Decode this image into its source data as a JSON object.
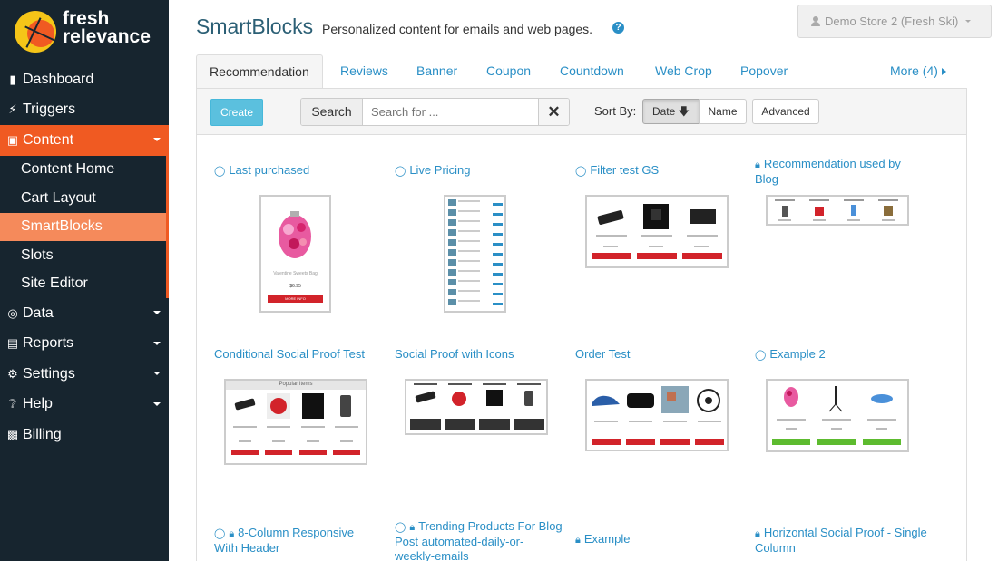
{
  "brand": {
    "line1": "fresh",
    "line2": "relevance"
  },
  "sidebar": {
    "items": [
      {
        "label": "Dashboard",
        "icon": "bookmark-icon"
      },
      {
        "label": "Triggers",
        "icon": "bolt-icon"
      },
      {
        "label": "Content",
        "icon": "image-icon"
      },
      {
        "label": "Data",
        "icon": "target-icon"
      },
      {
        "label": "Reports",
        "icon": "list-icon"
      },
      {
        "label": "Settings",
        "icon": "gear-icon"
      },
      {
        "label": "Help",
        "icon": "question-icon"
      },
      {
        "label": "Billing",
        "icon": "briefcase-icon"
      }
    ],
    "content_sub": [
      "Content Home",
      "Cart Layout",
      "SmartBlocks",
      "Slots",
      "Site Editor"
    ]
  },
  "header": {
    "title": "SmartBlocks",
    "subtitle": "Personalized content for emails and web pages.",
    "store": "Demo Store 2 (Fresh Ski)"
  },
  "tabs": [
    "Recommendation",
    "Reviews",
    "Banner",
    "Coupon",
    "Countdown",
    "Web Crop",
    "Popover"
  ],
  "tabs_more": "More (4)",
  "toolbar": {
    "create": "Create",
    "search_label": "Search",
    "search_placeholder": "Search for ...",
    "sort_by": "Sort By:",
    "sort_date": "Date",
    "sort_name": "Name",
    "advanced": "Advanced"
  },
  "cards": [
    {
      "title": "Last purchased",
      "icons": "eye"
    },
    {
      "title": "Live Pricing",
      "icons": "eye"
    },
    {
      "title": "Filter test GS",
      "icons": "eye"
    },
    {
      "title": "Recommendation used by Blog",
      "icons": "lock"
    },
    {
      "title": "Conditional Social Proof Test",
      "icons": ""
    },
    {
      "title": "Social Proof with Icons",
      "icons": ""
    },
    {
      "title": "Order Test",
      "icons": ""
    },
    {
      "title": "Example 2",
      "icons": "eye"
    },
    {
      "title": "8-Column Responsive With Header",
      "icons": "eye-lock"
    },
    {
      "title": "Trending Products For Blog Post automated-daily-or-weekly-emails",
      "icons": "eye-lock"
    },
    {
      "title": "Example",
      "icons": "lock"
    },
    {
      "title": "Horizontal Social Proof - Single Column",
      "icons": "lock"
    }
  ],
  "thumbs": {
    "valentine": {
      "name": "Valentine Sweets Bag",
      "price": "$6.95",
      "btn": "MORE INFO"
    },
    "popular": "Popular Items"
  },
  "colors": {
    "sidebar": "#17252f",
    "accent": "#f05a22",
    "link": "#2a8fc6",
    "create": "#5bc0de"
  }
}
